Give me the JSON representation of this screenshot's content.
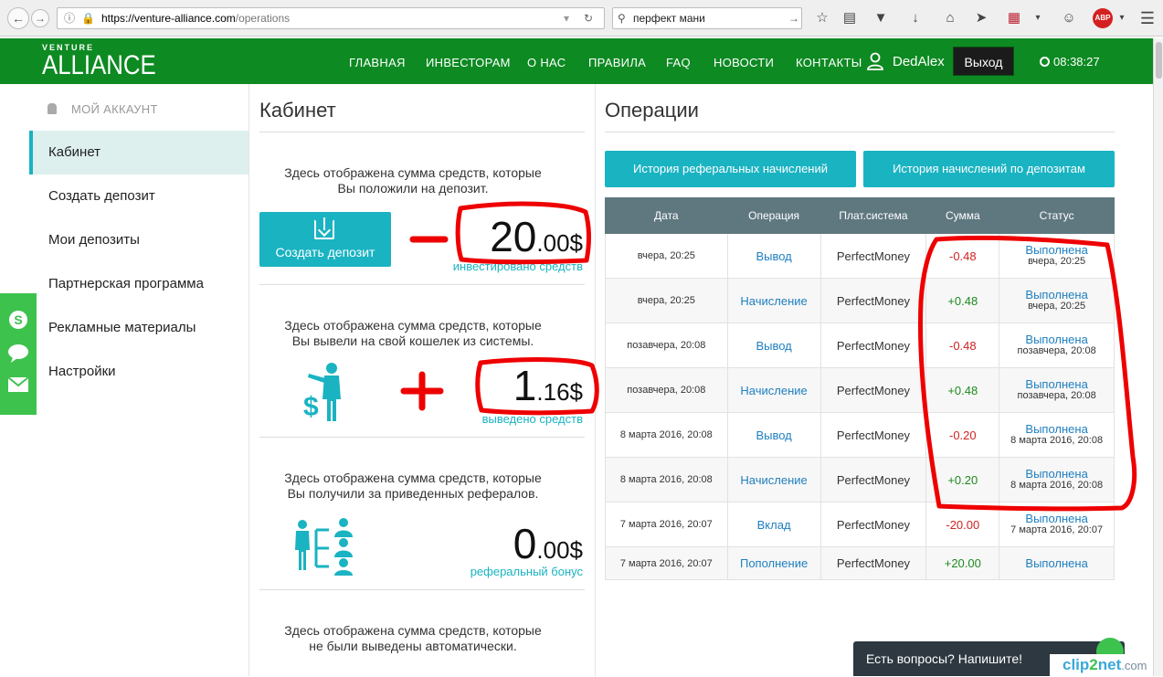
{
  "browser": {
    "url_host": "https://venture-alliance.com",
    "url_path": "/operations",
    "search_value": "перфект мани",
    "abp_badge": "ABP"
  },
  "header": {
    "logo_small": "VENTURE",
    "logo_big": "ALLIANCE",
    "nav": [
      "ГЛАВНАЯ",
      "ИНВЕСТОРАМ",
      "О НАС",
      "ПРАВИЛА",
      "FAQ",
      "НОВОСТИ",
      "КОНТАКТЫ"
    ],
    "username": "DedAlex",
    "logout": "Выход",
    "clock": "08:38:27"
  },
  "sidebar": {
    "account_label": "МОЙ АККАУНТ",
    "items": [
      {
        "label": "Кабинет",
        "active": true
      },
      {
        "label": "Создать депозит"
      },
      {
        "label": "Мои депозиты"
      },
      {
        "label": "Партнерская программа"
      },
      {
        "label": "Рекламные материалы"
      },
      {
        "label": "Настройки"
      }
    ]
  },
  "cabinet": {
    "title": "Кабинет",
    "create_button": "Создать депозит",
    "blocks": [
      {
        "line1": "Здесь отображена сумма средств, которые",
        "line2": "Вы положили на депозит.",
        "amount_main": "20",
        "amount_cents": ".00$",
        "label": "инвестировано средств"
      },
      {
        "line1": "Здесь отображена сумма средств, которые",
        "line2": "Вы вывели на свой кошелек из системы.",
        "amount_main": "1",
        "amount_cents": ".16$",
        "label": "выведено средств"
      },
      {
        "line1": "Здесь отображена сумма средств, которые",
        "line2": "Вы получили за приведенных рефералов.",
        "amount_main": "0",
        "amount_cents": ".00$",
        "label": "реферальный бонус"
      },
      {
        "line1": "Здесь отображена сумма средств, которые",
        "line2": "не были выведены автоматически."
      }
    ]
  },
  "operations": {
    "title": "Операции",
    "buttons": [
      "История реферальных начислений",
      "История начислений по депозитам"
    ],
    "columns": [
      "Дата",
      "Операция",
      "Плат.система",
      "Сумма",
      "Статус"
    ],
    "rows": [
      {
        "date": "вчера, 20:25",
        "op": "Вывод",
        "system": "PerfectMoney",
        "amount": "-0.48",
        "status": "Выполнена",
        "status_date": "вчера, 20:25"
      },
      {
        "date": "вчера, 20:25",
        "op": "Начисление",
        "system": "PerfectMoney",
        "amount": "+0.48",
        "status": "Выполнена",
        "status_date": "вчера, 20:25"
      },
      {
        "date": "позавчера, 20:08",
        "op": "Вывод",
        "system": "PerfectMoney",
        "amount": "-0.48",
        "status": "Выполнена",
        "status_date": "позавчера, 20:08"
      },
      {
        "date": "позавчера, 20:08",
        "op": "Начисление",
        "system": "PerfectMoney",
        "amount": "+0.48",
        "status": "Выполнена",
        "status_date": "позавчера, 20:08"
      },
      {
        "date": "8 марта 2016, 20:08",
        "op": "Вывод",
        "system": "PerfectMoney",
        "amount": "-0.20",
        "status": "Выполнена",
        "status_date": "8 марта 2016, 20:08"
      },
      {
        "date": "8 марта 2016, 20:08",
        "op": "Начисление",
        "system": "PerfectMoney",
        "amount": "+0.20",
        "status": "Выполнена",
        "status_date": "8 марта 2016, 20:08"
      },
      {
        "date": "7 марта 2016, 20:07",
        "op": "Вклад",
        "system": "PerfectMoney",
        "amount": "-20.00",
        "status": "Выполнена",
        "status_date": "7 марта 2016, 20:07"
      },
      {
        "date": "7 марта 2016, 20:07",
        "op": "Пополнение",
        "system": "PerfectMoney",
        "amount": "+20.00",
        "status": "Выполнена",
        "status_date": ""
      }
    ]
  },
  "chat": {
    "label": "Есть вопросы? Напишите!"
  },
  "watermark": {
    "a": "clip",
    "b": "2",
    "c": "net",
    "d": ".com"
  },
  "colors": {
    "brand_green": "#0d8a22",
    "accent_teal": "#1ab3c2",
    "table_header": "#5f7880",
    "negative": "#d32222",
    "positive": "#1d8a1d",
    "annotation_red": "#ee0000"
  }
}
